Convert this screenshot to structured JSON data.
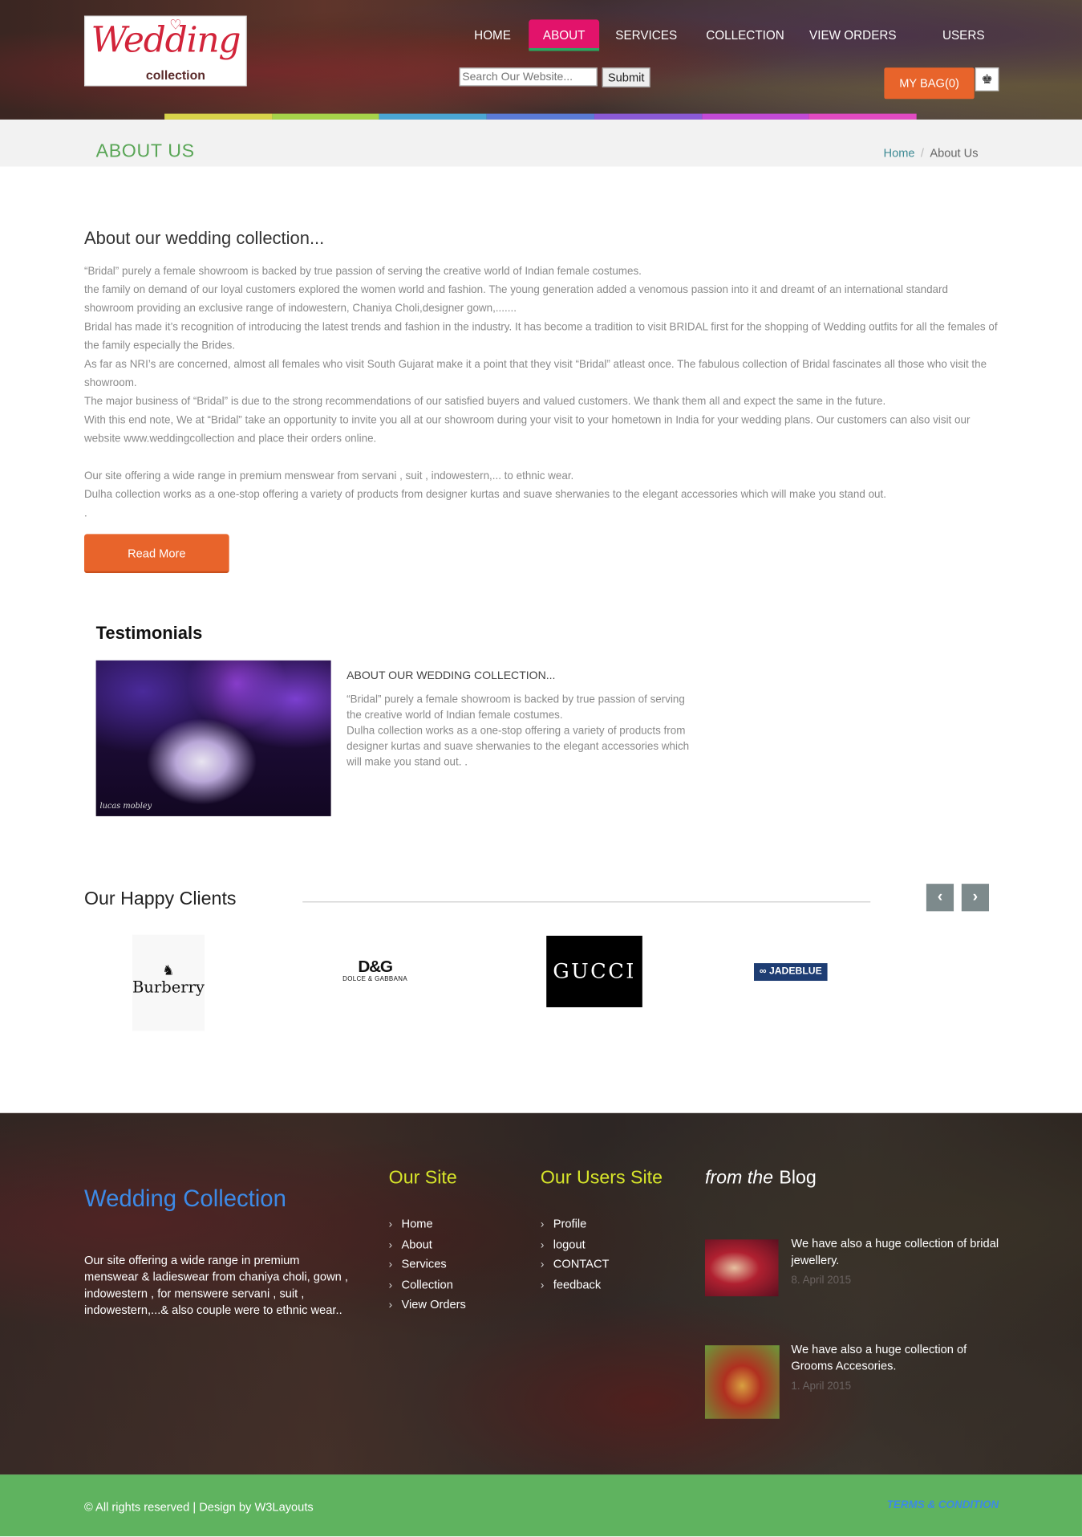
{
  "header": {
    "logo_word": "Wedding",
    "logo_sub": "collection",
    "nav": [
      "HOME",
      "ABOUT",
      "SERVICES",
      "COLLECTION",
      "VIEW ORDERS",
      "USERS"
    ],
    "active_nav": "ABOUT",
    "search_placeholder": "Search Our Website...",
    "submit_label": "Submit",
    "bag_label": "MY BAG(0)",
    "rainbow_colors": [
      "#d8d34a",
      "#a6d44a",
      "#4aa6d4",
      "#5a7bd6",
      "#8a5ad6",
      "#c24ad6",
      "#e14ac2"
    ]
  },
  "page_title": {
    "title": "ABOUT US",
    "breadcrumb_home": "Home",
    "breadcrumb_sep": "/",
    "breadcrumb_current": "About Us"
  },
  "about": {
    "heading": "About our wedding collection...",
    "paragraphs": [
      "“Bridal” purely a female showroom is backed by true passion of serving the creative world of Indian female costumes.",
      "the family on demand of our loyal customers explored the women world and fashion. The young generation added a venomous passion into it and dreamt of an international standard showroom providing an exclusive range of indowestern, Chaniya Choli,designer gown,.......",
      "Bridal has made it’s recognition of introducing the latest trends and fashion in the industry. It has become a tradition to visit BRIDAL first for the shopping of Wedding outfits for all the females of the family especially the Brides.",
      "As far as NRI’s are concerned, almost all females who visit South Gujarat make it a point that they visit “Bridal” atleast once. The fabulous collection of Bridal fascinates all those who visit the showroom.",
      "The major business of “Bridal” is due to the strong recommendations of our satisfied buyers and valued customers. We thank them all and expect the same in the future.",
      "With this end note, We at “Bridal” take an opportunity to invite you all at our showroom during your visit to your hometown in India for your wedding plans. Our customers can also visit our website www.weddingcollection and place their orders online.",
      "",
      "Our site offering a wide range in premium menswear from servani , suit , indowestern,... to ethnic wear.",
      "Dulha collection works as a one-stop offering a variety of products from designer kurtas and suave sherwanies to the elegant accessories which will make you stand out.",
      "."
    ],
    "read_more": "Read More"
  },
  "testimonials": {
    "heading": "Testimonials",
    "image_signature": "lucas mobley",
    "title": "ABOUT OUR WEDDING COLLECTION...",
    "body": "“Bridal” purely a female showroom is backed by true passion of serving the creative world of Indian female costumes.\nDulha collection works as a one-stop offering a variety of products from designer kurtas and suave sherwanies to the elegant accessories which will make you stand out. ."
  },
  "clients": {
    "heading": "Our Happy Clients",
    "prev_icon": "‹",
    "next_icon": "›",
    "brands": {
      "burberry": "Burberry",
      "dg_main": "D&G",
      "dg_sub": "DOLCE & GABBANA",
      "gucci": "GUCCI",
      "jadeblue": "∞ JADEBLUE"
    }
  },
  "footer": {
    "brand": "Wedding Collection",
    "text": "Our site offering a wide range in premium menswear & ladieswear from chaniya choli, gown , indowestern , for menswere servani , suit , indowestern,...& also couple were to ethnic wear..",
    "our_site_heading": "Our Site",
    "our_site_links": [
      "Home",
      "About",
      "Services",
      "Collection",
      "View Orders"
    ],
    "users_site_heading": "Our Users Site",
    "users_site_links": [
      "Profile",
      "logout",
      "CONTACT",
      "feedback"
    ],
    "blog_heading_em": "from the",
    "blog_heading": "Blog",
    "blog_posts": [
      {
        "title": "We have also a huge collection of bridal jewellery.",
        "date": "8. April 2015"
      },
      {
        "title": "We have also a huge collection of Grooms Accesories.",
        "date": "1. April 2015"
      }
    ],
    "copyright": "© All rights reserved | Design by W3Layouts",
    "terms": "TERMS & CONDITION"
  }
}
